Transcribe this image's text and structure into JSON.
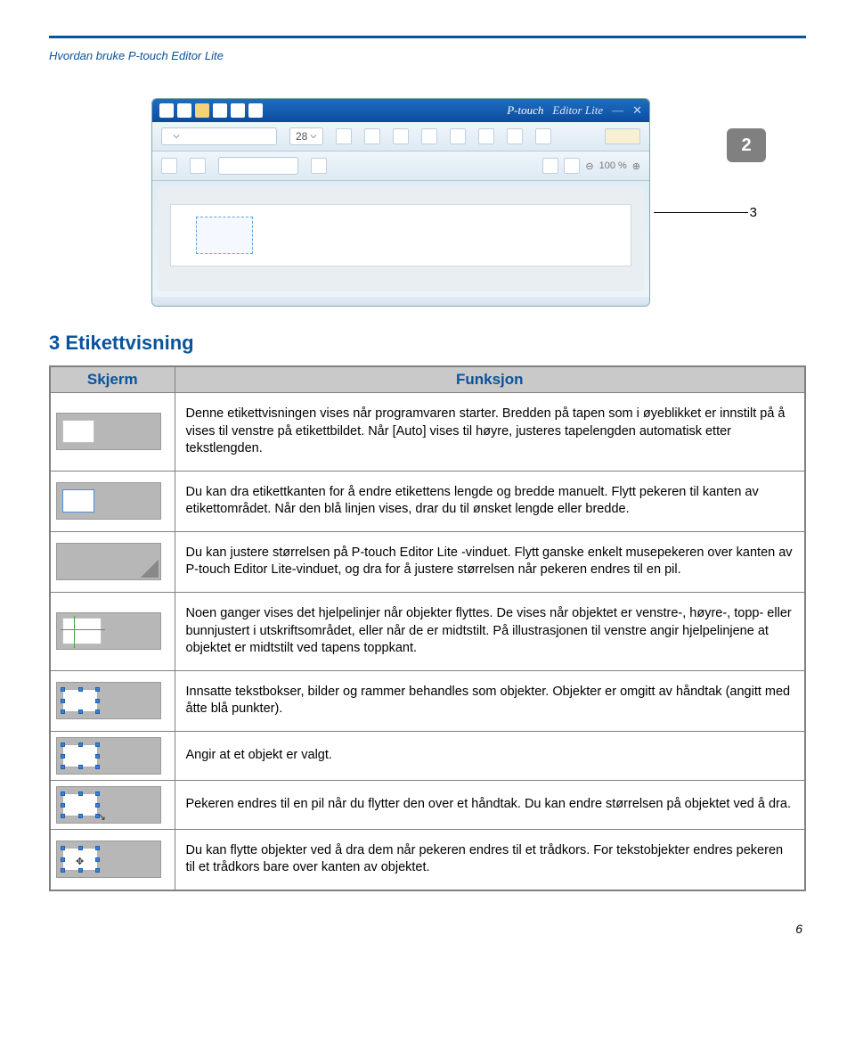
{
  "breadcrumb": "Hvordan bruke P-touch Editor Lite",
  "chapter_badge": "2",
  "callout_number": "3",
  "heading": "3  Etikettvisning",
  "table_headers": {
    "col1": "Skjerm",
    "col2": "Funksjon"
  },
  "app": {
    "title": "P-touch",
    "subtitle": "Editor Lite",
    "font_size": "28",
    "zoom": "100 %"
  },
  "rows": [
    "Denne etikettvisningen vises når programvaren starter. Bredden på tapen som i øyeblikket er innstilt på å vises til venstre på etikettbildet. Når [Auto] vises til høyre, justeres tapelengden automatisk etter tekstlengden.",
    "Du kan dra etikettkanten for å endre etikettens lengde og bredde manuelt. Flytt pekeren til kanten av etikettområdet. Når den blå linjen vises, drar du til ønsket lengde eller bredde.",
    "Du kan justere størrelsen på P-touch Editor Lite -vinduet. Flytt ganske enkelt musepekeren over kanten av P-touch Editor Lite-vinduet, og dra for å justere størrelsen når pekeren endres til en pil.",
    "Noen ganger vises det hjelpelinjer når objekter flyttes. De vises når objektet er venstre-, høyre-, topp- eller bunnjustert i utskriftsområdet, eller når de er midtstilt. På illustrasjonen til venstre angir hjelpelinjene at objektet er midtstilt ved tapens toppkant.",
    "Innsatte tekstbokser, bilder og rammer behandles som objekter. Objekter er omgitt av håndtak (angitt med åtte blå punkter).",
    "Angir at et objekt er valgt.",
    "Pekeren endres til en pil når du flytter den over et håndtak. Du kan endre størrelsen på objektet ved å dra.",
    "Du kan flytte objekter ved å dra dem når pekeren endres til et trådkors. For tekstobjekter endres pekeren til et trådkors bare over kanten av objektet."
  ],
  "page_number": "6"
}
